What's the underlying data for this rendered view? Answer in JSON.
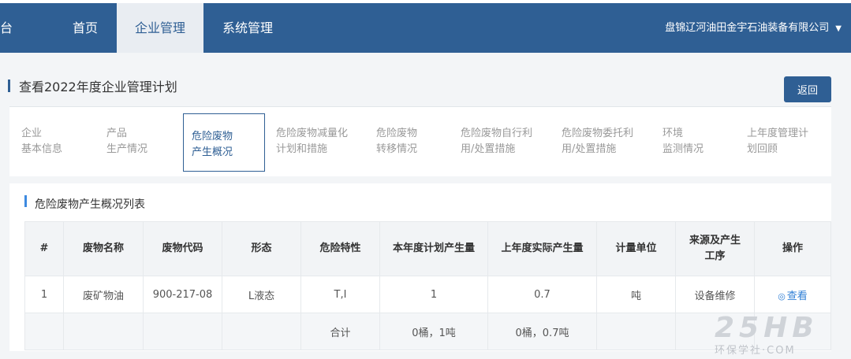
{
  "nav": {
    "partial_left": "台",
    "items": [
      "首页",
      "企业管理",
      "系统管理"
    ],
    "company": "盘锦辽河油田金宇石油装备有限公司",
    "caret": "▼"
  },
  "page": {
    "title": "查看2022年度企业管理计划",
    "back_label": "返回"
  },
  "tabs": [
    {
      "line1": "企业",
      "line2": "基本信息"
    },
    {
      "line1": "产品",
      "line2": "生产情况"
    },
    {
      "line1": "危险废物",
      "line2": "产生概况"
    },
    {
      "line1": "危险废物减量化",
      "line2": "计划和措施"
    },
    {
      "line1": "危险废物",
      "line2": "转移情况"
    },
    {
      "line1": "危险废物自行利",
      "line2": "用/处置措施"
    },
    {
      "line1": "危险废物委托利",
      "line2": "用/处置措施"
    },
    {
      "line1": "环境",
      "line2": "监测情况"
    },
    {
      "line1": "上年度管理计",
      "line2": "划回顾"
    }
  ],
  "section": {
    "title": "危险废物产生概况列表"
  },
  "table": {
    "headers": [
      "#",
      "废物名称",
      "废物代码",
      "形态",
      "危险特性",
      "本年度计划产生量",
      "上年度实际产生量",
      "计量单位",
      "来源及产生工序",
      "操作"
    ],
    "header_source_line1": "来源及产生",
    "header_source_line2": "工序",
    "row": {
      "no": "1",
      "name": "废矿物油",
      "code": "900-217-08",
      "form": "L液态",
      "hazard": "T,I",
      "plan": "1",
      "actual": "0.7",
      "unit": "吨",
      "source": "设备维修",
      "action": "查看"
    },
    "summary": {
      "label": "合计",
      "plan": "0桶，1吨",
      "actual": "0桶，0.7吨"
    }
  },
  "watermark": {
    "logo": "25HB",
    "text": "环保学社·COM"
  }
}
